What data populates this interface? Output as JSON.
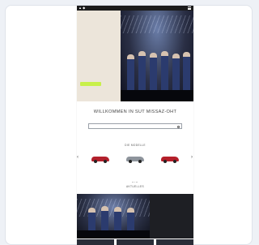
{
  "header": {
    "brand": "▲ ◆"
  },
  "hero": {
    "label": "",
    "title": "",
    "body": "",
    "button_label": ""
  },
  "welcome_title": "WILLKOMMEN IN SUT MISSAZ-OHT",
  "search": {
    "placeholder": ""
  },
  "models": {
    "heading": "DIE MODELLE",
    "cars": [
      {
        "name": "",
        "color": "#b3202c"
      },
      {
        "name": "",
        "color": "#8e949c"
      },
      {
        "name": "",
        "color": "#b51f2a"
      }
    ]
  },
  "news": {
    "heading": "AKTUELLES",
    "label": "",
    "title": "",
    "body": ""
  },
  "colors": {
    "accent": "#c8f04a",
    "dark": "#1e1f24",
    "hero_bg": "#ece5da"
  }
}
